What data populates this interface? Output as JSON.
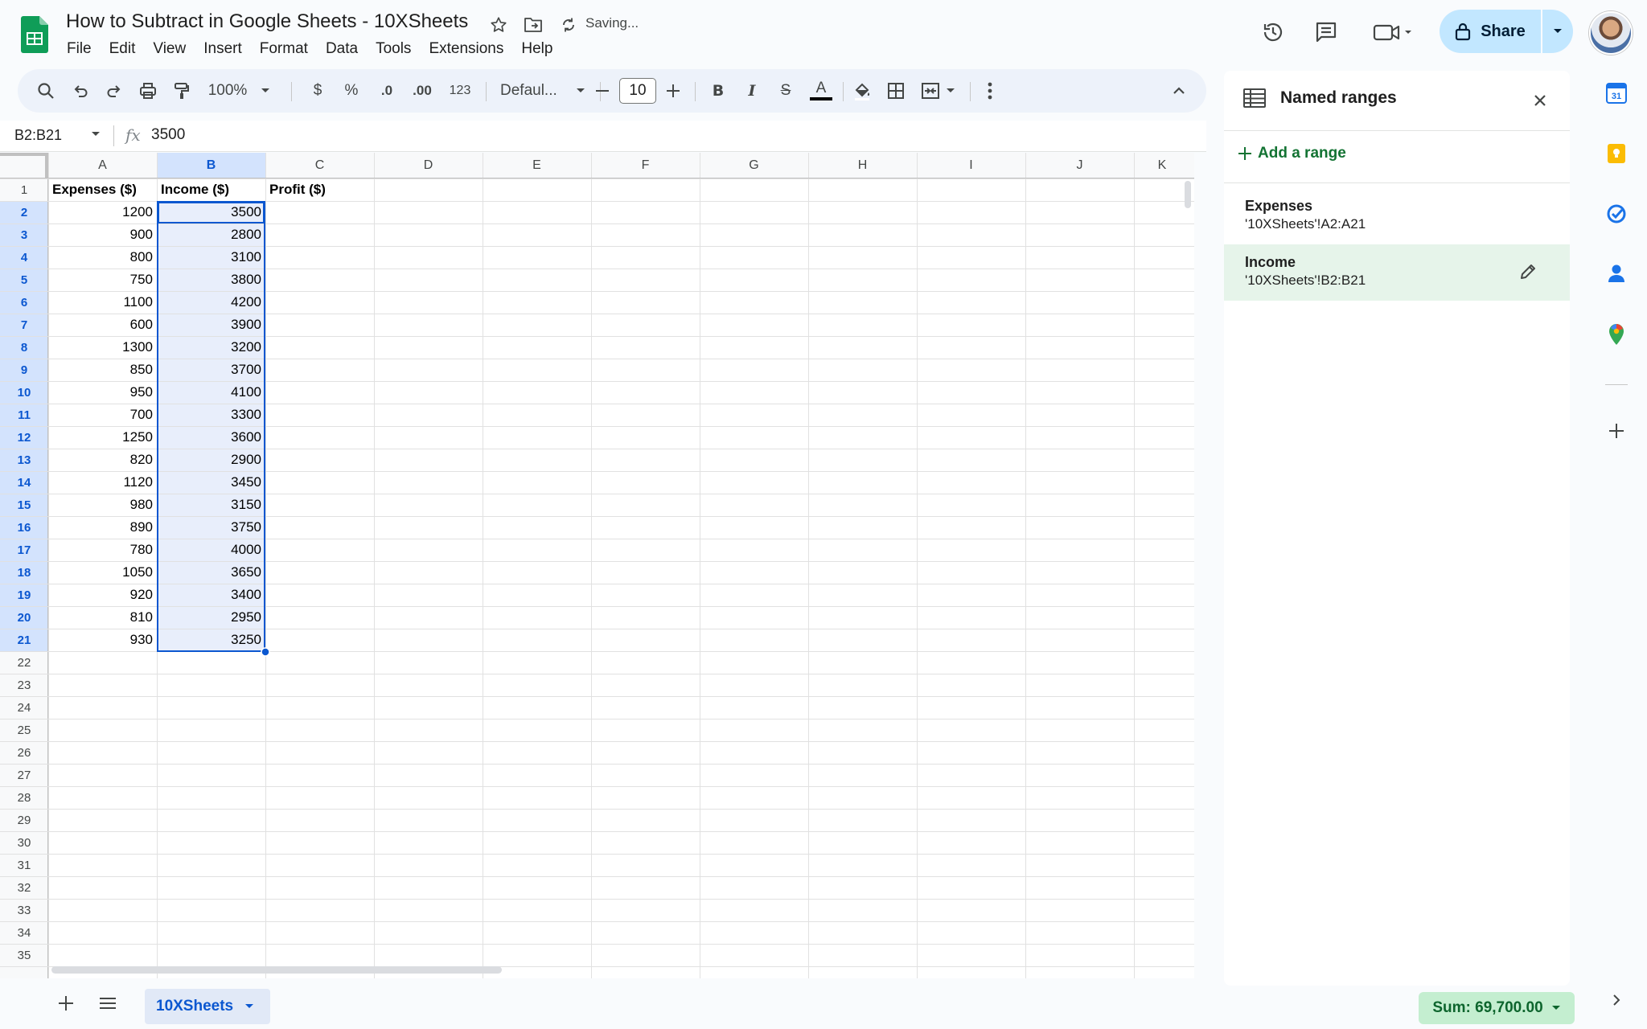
{
  "header": {
    "title": "How to Subtract in Google Sheets - 10XSheets",
    "status": "Saving...",
    "share_label": "Share",
    "menu": [
      "File",
      "Edit",
      "View",
      "Insert",
      "Format",
      "Data",
      "Tools",
      "Extensions",
      "Help"
    ],
    "icons": [
      "sheets-logo",
      "star-icon",
      "move-to-folder-icon",
      "sync-icon",
      "history-icon",
      "comments-icon",
      "meet-icon",
      "lock-icon",
      "avatar"
    ]
  },
  "toolbar": {
    "zoom": "100%",
    "currency": "$",
    "percent": "%",
    "dec_decrease": ".0",
    "dec_increase": ".00",
    "number_format": "123",
    "font": "Defaul...",
    "font_size": "10",
    "bold": "B",
    "italic": "I",
    "strike": "S",
    "text_color": "A",
    "text_color_value": "#000000"
  },
  "formula_bar": {
    "name_box": "B2:B21",
    "fx": "fx",
    "value": "3500"
  },
  "grid": {
    "columns": [
      "A",
      "B",
      "C",
      "D",
      "E",
      "F",
      "G",
      "H",
      "I",
      "J",
      "K"
    ],
    "selected_column": "B",
    "selected_rows": [
      2,
      21
    ],
    "visible_row_count": 35,
    "headers": [
      "Expenses ($)",
      "Income ($)",
      "Profit ($)"
    ],
    "expenses": [
      1200,
      900,
      800,
      750,
      1100,
      600,
      1300,
      850,
      950,
      700,
      1250,
      820,
      1120,
      980,
      890,
      780,
      1050,
      920,
      810,
      930
    ],
    "income": [
      3500,
      2800,
      3100,
      3800,
      4200,
      3900,
      3200,
      3700,
      4100,
      3300,
      3600,
      2900,
      3450,
      3150,
      3750,
      4000,
      3650,
      3400,
      2950,
      3250
    ],
    "selection_color": "#0b57d0",
    "selection_fill": "#e8eefb"
  },
  "bottom": {
    "sheet_tab": "10XSheets",
    "sum": "Sum: 69,700.00"
  },
  "named_ranges": {
    "title": "Named ranges",
    "add_label": "Add a range",
    "items": [
      {
        "name": "Expenses",
        "ref": "'10XSheets'!A2:A21"
      },
      {
        "name": "Income",
        "ref": "'10XSheets'!B2:B21"
      }
    ],
    "selected_index": 1,
    "accent": "#137333"
  },
  "side_rail": {
    "icons": [
      "calendar-icon",
      "keep-icon",
      "tasks-icon",
      "contacts-icon",
      "maps-icon",
      "add-addon-icon"
    ]
  },
  "colors": {
    "share_bg": "#c2e7ff",
    "toolbar_bg": "#edf2fa",
    "sum_chip_bg": "#c4eed0",
    "sheets_green": "#0f9d58"
  }
}
